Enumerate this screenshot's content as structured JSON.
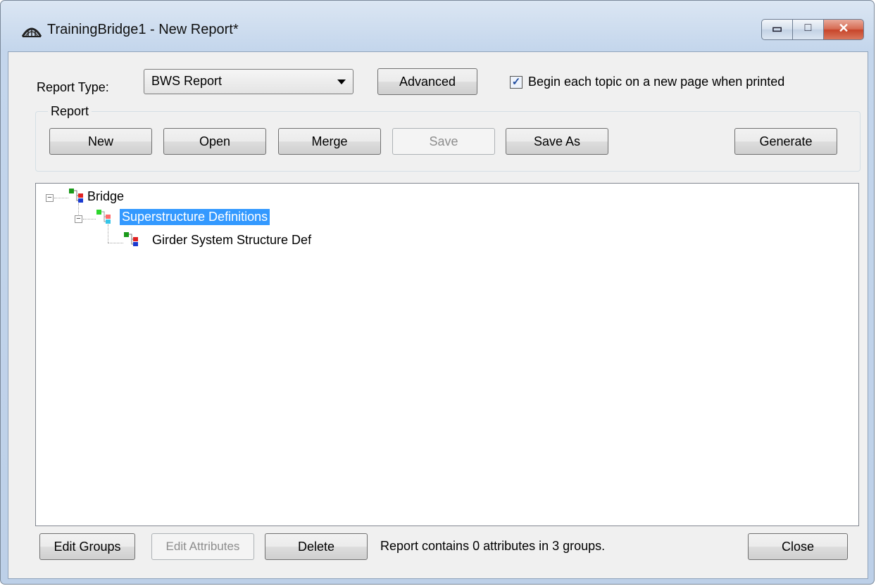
{
  "window": {
    "title": "TrainingBridge1 - New Report*"
  },
  "caption": {
    "minimize_glyph": "▭",
    "maximize_glyph": "□",
    "close_glyph": "✕"
  },
  "report_type": {
    "label": "Report Type:",
    "value": "BWS Report"
  },
  "advanced_label": "Advanced",
  "begin_topic": {
    "label": "Begin each topic on a new page when printed",
    "checked": true
  },
  "report_group": {
    "label": "Report",
    "buttons": {
      "new": "New",
      "open": "Open",
      "merge": "Merge",
      "save": "Save",
      "save_as": "Save As",
      "generate": "Generate"
    }
  },
  "tree": {
    "nodes": [
      {
        "label": "Bridge",
        "level": 0,
        "expanded": true
      },
      {
        "label": "Superstructure Definitions",
        "level": 1,
        "expanded": true,
        "selected": true
      },
      {
        "label": "Girder System Structure Def",
        "level": 2
      }
    ]
  },
  "bottom": {
    "edit_groups": "Edit Groups",
    "edit_attributes": "Edit Attributes",
    "delete": "Delete",
    "status": "Report contains 0 attributes in 3 groups.",
    "close": "Close"
  }
}
